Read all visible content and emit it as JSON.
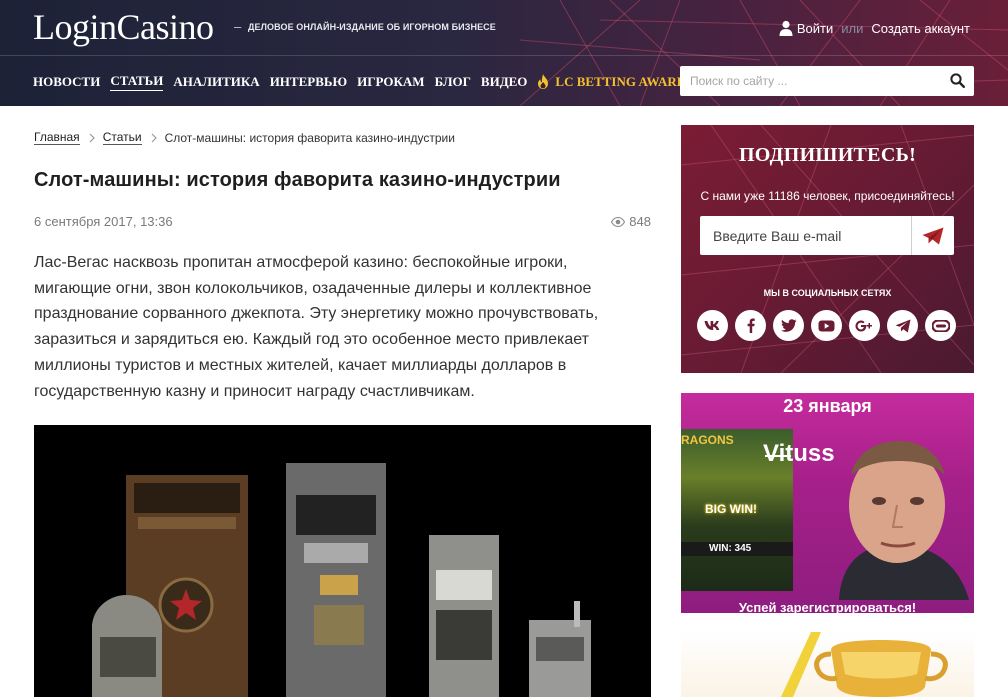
{
  "header": {
    "logo": "LoginCasino",
    "logo_dash": "–",
    "tagline": "ДЕЛОВОЕ ОНЛАЙН-ИЗДАНИЕ ОБ ИГОРНОМ БИЗНЕСЕ",
    "auth": {
      "login": "Войти",
      "or": "или",
      "register": "Создать аккаунт"
    },
    "nav": [
      {
        "label": "НОВОСТИ"
      },
      {
        "label": "СТАТЬИ",
        "active": true
      },
      {
        "label": "АНАЛИТИКА"
      },
      {
        "label": "ИНТЕРВЬЮ"
      },
      {
        "label": "ИГРОКАМ"
      },
      {
        "label": "БЛОГ"
      },
      {
        "label": "ВИДЕО"
      },
      {
        "label": "LC BETTING AWARDS",
        "icon": "flame-icon",
        "color": "#f2c12e"
      }
    ],
    "search": {
      "placeholder": "Поиск по сайту ..."
    }
  },
  "breadcrumb": {
    "home": "Главная",
    "section": "Статьи",
    "current": "Слот-машины: история фаворита казино-индустрии"
  },
  "article": {
    "title": "Слот-машины: история фаворита казино-индустрии",
    "date": "6 сентября 2017, 13:36",
    "views": "848",
    "lead": "Лас-Вегас насквозь пропитан атмосферой казино: беспокойные игроки, мигающие огни, звон колокольчиков, озадаченные дилеры и коллективное празднование сорванного джекпота. Эту энергетику можно прочувствовать, заразиться и зарядиться ею. Каждый год это особенное место привлекает миллионы туристов и местных жителей, качает миллиарды долларов в государственную казну и приносит награду счастливчикам."
  },
  "subscribe": {
    "title": "ПОДПИШИТЕСЬ!",
    "text": "С нами уже 11186 человек, присоединяйтесь!",
    "email_placeholder": "Введите Ваш e-mail",
    "social_label": "МЫ В СОЦИАЛЬНЫХ СЕТЯХ",
    "social": [
      "vk-icon",
      "facebook-icon",
      "twitter-icon",
      "youtube-icon",
      "google-plus-icon",
      "telegram-icon",
      "rss-icon"
    ]
  },
  "banner": {
    "date": "23 января",
    "name": "Vituss",
    "game_title": "RAGONS",
    "big_win": "BIG WIN!",
    "win": "WIN: 345",
    "cta": "Успей зарегистрироваться!"
  },
  "colors": {
    "brand": "#6b1b32",
    "accent_gold": "#f2c12e",
    "header_dark": "#1d2237"
  }
}
